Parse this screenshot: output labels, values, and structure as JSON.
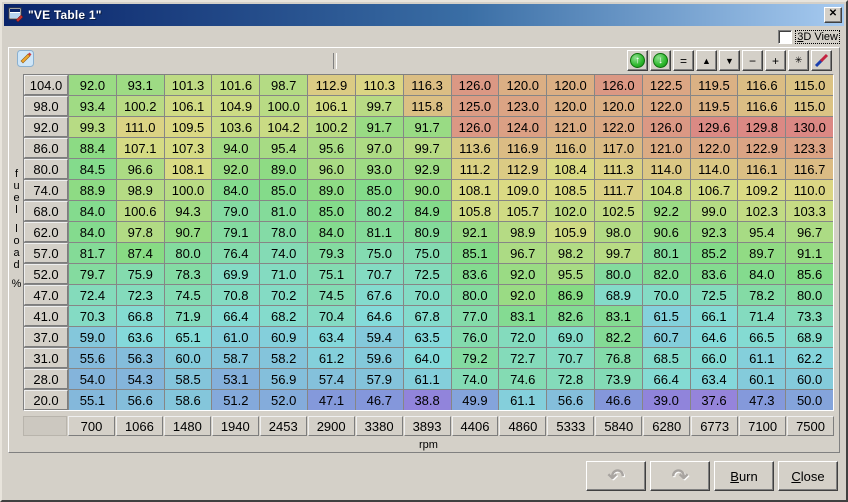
{
  "window": {
    "title": "\"VE Table 1\"",
    "close_label": "x"
  },
  "view_toggle": {
    "label": "3D View",
    "checked": false
  },
  "toolbar": {
    "buttons": [
      {
        "name": "shift-values-up-button",
        "icon": "green-arrow-up-icon",
        "glyph": "↑",
        "style": "green"
      },
      {
        "name": "shift-values-down-button",
        "icon": "green-arrow-down-icon",
        "glyph": "↓",
        "style": "green"
      },
      {
        "name": "set-equal-button",
        "icon": "equals-icon",
        "glyph": "=",
        "style": "plain"
      },
      {
        "name": "increment-button",
        "icon": "triangle-up-icon",
        "glyph": "▲",
        "style": "small"
      },
      {
        "name": "decrement-button",
        "icon": "triangle-down-icon",
        "glyph": "▼",
        "style": "small"
      },
      {
        "name": "minus-button",
        "icon": "minus-icon",
        "glyph": "−",
        "style": "plain"
      },
      {
        "name": "plus-button",
        "icon": "plus-icon",
        "glyph": "+",
        "style": "plain"
      },
      {
        "name": "scale-button",
        "icon": "asterisk-icon",
        "glyph": "✳",
        "style": "small"
      },
      {
        "name": "edit-pencil-button",
        "icon": "pencil-icon",
        "glyph": "pencil",
        "style": "pencil"
      }
    ]
  },
  "table": {
    "y_axis_label": "fuel load %",
    "x_axis_label": "rpm",
    "y_values": [
      "104.0",
      "98.0",
      "92.0",
      "86.0",
      "80.0",
      "74.0",
      "68.0",
      "62.0",
      "57.0",
      "52.0",
      "47.0",
      "41.0",
      "37.0",
      "31.0",
      "28.0",
      "20.0"
    ],
    "x_values": [
      "700",
      "1066",
      "1480",
      "1940",
      "2453",
      "2900",
      "3380",
      "3893",
      "4406",
      "4860",
      "5333",
      "5840",
      "6280",
      "6773",
      "7100",
      "7500"
    ],
    "rows": [
      [
        "92.0",
        "93.1",
        "101.3",
        "101.6",
        "98.7",
        "112.9",
        "110.3",
        "116.3",
        "126.0",
        "120.0",
        "120.0",
        "126.0",
        "122.5",
        "119.5",
        "116.6",
        "115.0"
      ],
      [
        "93.4",
        "100.2",
        "106.1",
        "104.9",
        "100.0",
        "106.1",
        "99.7",
        "115.8",
        "125.0",
        "123.0",
        "120.0",
        "120.0",
        "122.0",
        "119.5",
        "116.6",
        "115.0"
      ],
      [
        "99.3",
        "111.0",
        "109.5",
        "103.6",
        "104.2",
        "100.2",
        "91.7",
        "91.7",
        "126.0",
        "124.0",
        "121.0",
        "122.0",
        "126.0",
        "129.6",
        "129.8",
        "130.0"
      ],
      [
        "88.4",
        "107.1",
        "107.3",
        "94.0",
        "95.4",
        "95.6",
        "97.0",
        "99.7",
        "113.6",
        "116.9",
        "116.0",
        "117.0",
        "121.0",
        "122.0",
        "122.9",
        "123.3"
      ],
      [
        "84.5",
        "96.6",
        "108.1",
        "92.0",
        "89.0",
        "96.0",
        "93.0",
        "92.9",
        "111.2",
        "112.9",
        "108.4",
        "111.3",
        "114.0",
        "114.0",
        "116.1",
        "116.7"
      ],
      [
        "88.9",
        "98.9",
        "100.0",
        "84.0",
        "85.0",
        "89.0",
        "85.0",
        "90.0",
        "108.1",
        "109.0",
        "108.5",
        "111.7",
        "104.8",
        "106.7",
        "109.2",
        "110.0"
      ],
      [
        "84.0",
        "100.6",
        "94.3",
        "79.0",
        "81.0",
        "85.0",
        "80.2",
        "84.9",
        "105.8",
        "105.7",
        "102.0",
        "102.5",
        "92.2",
        "99.0",
        "102.3",
        "103.3"
      ],
      [
        "84.0",
        "97.8",
        "90.7",
        "79.1",
        "78.0",
        "84.0",
        "81.1",
        "80.9",
        "92.1",
        "98.9",
        "105.9",
        "98.0",
        "90.6",
        "92.3",
        "95.4",
        "96.7"
      ],
      [
        "81.7",
        "87.4",
        "80.0",
        "76.4",
        "74.0",
        "79.3",
        "75.0",
        "75.0",
        "85.1",
        "96.7",
        "98.2",
        "99.7",
        "80.1",
        "85.2",
        "89.7",
        "91.1"
      ],
      [
        "79.7",
        "75.9",
        "78.3",
        "69.9",
        "71.0",
        "75.1",
        "70.7",
        "72.5",
        "83.6",
        "92.0",
        "95.5",
        "80.0",
        "82.0",
        "83.6",
        "84.0",
        "85.6"
      ],
      [
        "72.4",
        "72.3",
        "74.5",
        "70.8",
        "70.2",
        "74.5",
        "67.6",
        "70.0",
        "80.0",
        "92.0",
        "86.9",
        "68.9",
        "70.0",
        "72.5",
        "78.2",
        "80.0"
      ],
      [
        "70.3",
        "66.8",
        "71.9",
        "66.4",
        "68.2",
        "70.4",
        "64.6",
        "67.8",
        "77.0",
        "83.1",
        "82.6",
        "83.1",
        "61.5",
        "66.1",
        "71.4",
        "73.3"
      ],
      [
        "59.0",
        "63.6",
        "65.1",
        "61.0",
        "60.9",
        "63.4",
        "59.4",
        "63.5",
        "76.0",
        "72.0",
        "69.0",
        "82.2",
        "60.7",
        "64.6",
        "66.5",
        "68.9"
      ],
      [
        "55.6",
        "56.3",
        "60.0",
        "58.7",
        "58.2",
        "61.2",
        "59.6",
        "64.0",
        "79.2",
        "72.7",
        "70.7",
        "76.8",
        "68.5",
        "66.0",
        "61.1",
        "62.2"
      ],
      [
        "54.0",
        "54.3",
        "58.5",
        "53.1",
        "56.9",
        "57.4",
        "57.9",
        "61.1",
        "74.0",
        "74.6",
        "72.8",
        "73.9",
        "66.4",
        "63.4",
        "60.1",
        "60.0"
      ],
      [
        "55.1",
        "56.6",
        "58.6",
        "51.2",
        "52.0",
        "47.1",
        "46.7",
        "38.8",
        "49.9",
        "61.1",
        "56.6",
        "46.6",
        "39.0",
        "37.6",
        "47.3",
        "50.0"
      ]
    ],
    "heat_scale": {
      "min": 36,
      "max": 131,
      "hue_low": 256,
      "hue_high": 0,
      "saturation": "55%",
      "lightness": "69%"
    }
  },
  "footer": {
    "undo_icon": "undo-arrow-icon",
    "redo_icon": "redo-arrow-icon",
    "undo_glyph": "↶",
    "redo_glyph": "↷",
    "burn_label": "Burn",
    "close_label": "Close"
  }
}
